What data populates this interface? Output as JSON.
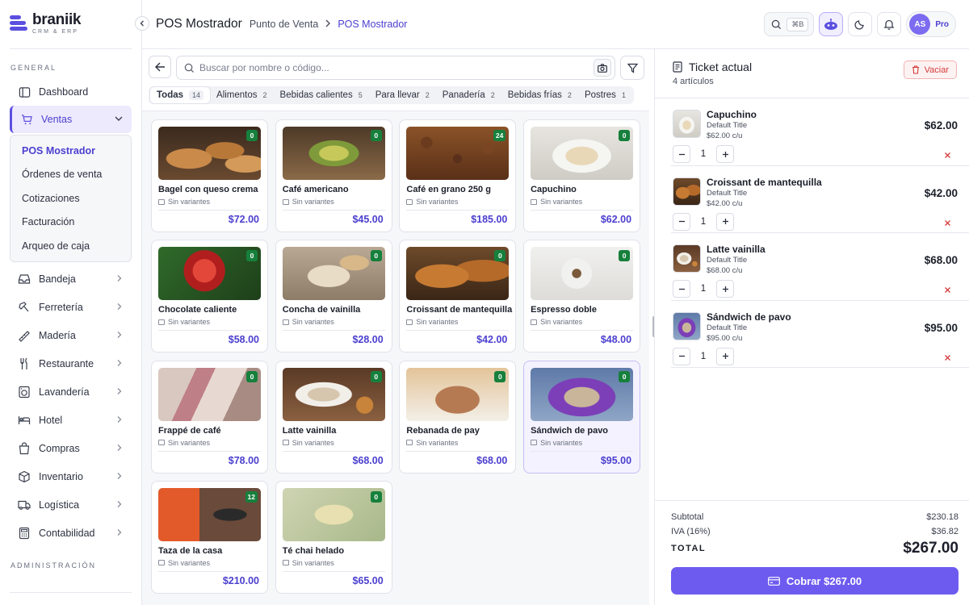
{
  "brand": {
    "name": "braniik",
    "tagline": "CRM & ERP"
  },
  "sidebar": {
    "section_general": "GENERAL",
    "section_admin": "ADMINISTRACIÓN",
    "items": [
      {
        "label": "Dashboard",
        "icon": "dashboard-icon"
      },
      {
        "label": "Ventas",
        "icon": "cart-icon"
      },
      {
        "label": "Bandeja",
        "icon": "tray-icon"
      },
      {
        "label": "Ferretería",
        "icon": "hammer-icon"
      },
      {
        "label": "Madería",
        "icon": "wood-icon"
      },
      {
        "label": "Restaurante",
        "icon": "utensils-icon"
      },
      {
        "label": "Lavandería",
        "icon": "laundry-icon"
      },
      {
        "label": "Hotel",
        "icon": "bed-icon"
      },
      {
        "label": "Compras",
        "icon": "bag-icon"
      },
      {
        "label": "Inventario",
        "icon": "box-icon"
      },
      {
        "label": "Logística",
        "icon": "truck-icon"
      },
      {
        "label": "Contabilidad",
        "icon": "calculator-icon"
      }
    ],
    "ventas_sub": [
      "POS Mostrador",
      "Órdenes de venta",
      "Cotizaciones",
      "Facturación",
      "Arqueo de caja"
    ]
  },
  "header": {
    "title": "POS Mostrador",
    "breadcrumb": [
      "Punto de Venta",
      "POS Mostrador"
    ],
    "shortcut": "⌘B",
    "user_initials": "AS",
    "plan": "Pro"
  },
  "search": {
    "placeholder": "Buscar por nombre o código..."
  },
  "categories": [
    {
      "label": "Todas",
      "count": "14"
    },
    {
      "label": "Alimentos",
      "count": "2"
    },
    {
      "label": "Bebidas calientes",
      "count": "5"
    },
    {
      "label": "Para llevar",
      "count": "2"
    },
    {
      "label": "Panadería",
      "count": "2"
    },
    {
      "label": "Bebidas frías",
      "count": "2"
    },
    {
      "label": "Postres",
      "count": "1"
    }
  ],
  "products": [
    {
      "name": "Bagel con queso crema",
      "variants": "Sin variantes",
      "price": "$72.00",
      "stock": "0"
    },
    {
      "name": "Café americano",
      "variants": "Sin variantes",
      "price": "$45.00",
      "stock": "0"
    },
    {
      "name": "Café en grano 250 g",
      "variants": "Sin variantes",
      "price": "$185.00",
      "stock": "24"
    },
    {
      "name": "Capuchino",
      "variants": "Sin variantes",
      "price": "$62.00",
      "stock": "0"
    },
    {
      "name": "Chocolate caliente",
      "variants": "Sin variantes",
      "price": "$58.00",
      "stock": "0"
    },
    {
      "name": "Concha de vainilla",
      "variants": "Sin variantes",
      "price": "$28.00",
      "stock": "0"
    },
    {
      "name": "Croissant de mantequilla",
      "variants": "Sin variantes",
      "price": "$42.00",
      "stock": "0"
    },
    {
      "name": "Espresso doble",
      "variants": "Sin variantes",
      "price": "$48.00",
      "stock": "0"
    },
    {
      "name": "Frappé de café",
      "variants": "Sin variantes",
      "price": "$78.00",
      "stock": "0"
    },
    {
      "name": "Latte vainilla",
      "variants": "Sin variantes",
      "price": "$68.00",
      "stock": "0"
    },
    {
      "name": "Rebanada de pay",
      "variants": "Sin variantes",
      "price": "$68.00",
      "stock": "0"
    },
    {
      "name": "Sándwich de pavo",
      "variants": "Sin variantes",
      "price": "$95.00",
      "stock": "0"
    },
    {
      "name": "Taza de la casa",
      "variants": "Sin variantes",
      "price": "$210.00",
      "stock": "12"
    },
    {
      "name": "Té chai helado",
      "variants": "Sin variantes",
      "price": "$65.00",
      "stock": "0"
    }
  ],
  "ticket": {
    "title": "Ticket actual",
    "count": "4 artículos",
    "clear_label": "Vaciar",
    "items": [
      {
        "name": "Capuchino",
        "variant": "Default Title",
        "unit": "$62.00 c/u",
        "qty": "1",
        "total": "$62.00"
      },
      {
        "name": "Croissant de mantequilla",
        "variant": "Default Title",
        "unit": "$42.00 c/u",
        "qty": "1",
        "total": "$42.00"
      },
      {
        "name": "Latte vainilla",
        "variant": "Default Title",
        "unit": "$68.00 c/u",
        "qty": "1",
        "total": "$68.00"
      },
      {
        "name": "Sándwich de pavo",
        "variant": "Default Title",
        "unit": "$95.00 c/u",
        "qty": "1",
        "total": "$95.00"
      }
    ],
    "subtotal_label": "Subtotal",
    "subtotal": "$230.18",
    "tax_label": "IVA (16%)",
    "tax": "$36.82",
    "total_label": "TOTAL",
    "total": "$267.00",
    "charge_label": "Cobrar $267.00"
  },
  "colors": {
    "accent": "#5b4fe0",
    "price": "#4b3fcf",
    "stock": "#16803c",
    "danger": "#d43a3a"
  }
}
